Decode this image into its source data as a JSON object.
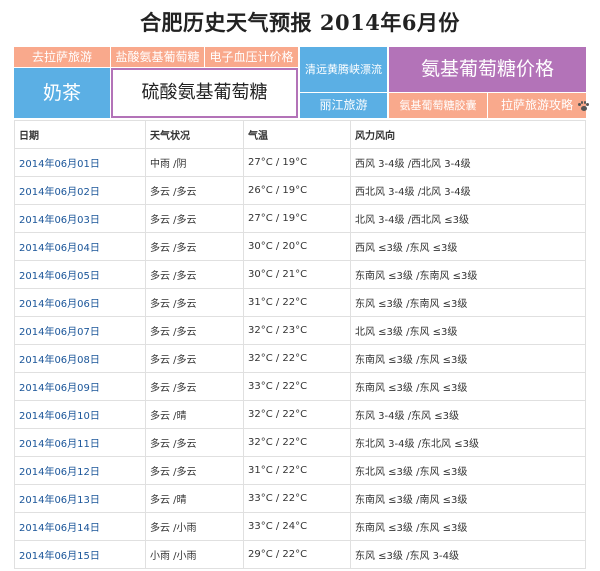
{
  "page": {
    "title": "合肥历史天气预报 2014年6月份"
  },
  "ads": {
    "lhasa_travel": "去拉萨旅游",
    "glucosamine_hcl": "盐酸氨基葡萄糖",
    "bp_monitor_price": "电子血压计价格",
    "milk_tea": "奶茶",
    "glucosamine_sulfate": "硫酸氨基葡萄糖",
    "qingyuan_rafting": "清远黄腾峡漂流",
    "glucosamine_price": "氨基葡萄糖价格",
    "lijiang_travel": "丽江旅游",
    "glucosamine_capsule": "氨基葡萄糖胶囊",
    "lhasa_guide": "拉萨旅游攻略",
    "colors": {
      "orange": "#f9a98c",
      "blue": "#5bafe4",
      "purple": "#b373b8"
    }
  },
  "table": {
    "headers": [
      "日期",
      "天气状况",
      "气温",
      "风力风向"
    ],
    "rows": [
      {
        "date": "2014年06月01日",
        "weather": "中雨 /阴",
        "temp": "27°C / 19°C",
        "wind": "西风 3-4级 /西北风 3-4级"
      },
      {
        "date": "2014年06月02日",
        "weather": "多云 /多云",
        "temp": "26°C / 19°C",
        "wind": "西北风 3-4级 /北风 3-4级"
      },
      {
        "date": "2014年06月03日",
        "weather": "多云 /多云",
        "temp": "27°C / 19°C",
        "wind": "北风 3-4级 /西北风 ≤3级"
      },
      {
        "date": "2014年06月04日",
        "weather": "多云 /多云",
        "temp": "30°C / 20°C",
        "wind": "西风 ≤3级 /东风 ≤3级"
      },
      {
        "date": "2014年06月05日",
        "weather": "多云 /多云",
        "temp": "30°C / 21°C",
        "wind": "东南风 ≤3级 /东南风 ≤3级"
      },
      {
        "date": "2014年06月06日",
        "weather": "多云 /多云",
        "temp": "31°C / 22°C",
        "wind": "东风 ≤3级 /东南风 ≤3级"
      },
      {
        "date": "2014年06月07日",
        "weather": "多云 /多云",
        "temp": "32°C / 23°C",
        "wind": "北风 ≤3级 /东风 ≤3级"
      },
      {
        "date": "2014年06月08日",
        "weather": "多云 /多云",
        "temp": "32°C / 22°C",
        "wind": "东南风 ≤3级 /东风 ≤3级"
      },
      {
        "date": "2014年06月09日",
        "weather": "多云 /多云",
        "temp": "33°C / 22°C",
        "wind": "东南风 ≤3级 /东风 ≤3级"
      },
      {
        "date": "2014年06月10日",
        "weather": "多云 /晴",
        "temp": "32°C / 22°C",
        "wind": "东风 3-4级 /东风 ≤3级"
      },
      {
        "date": "2014年06月11日",
        "weather": "多云 /多云",
        "temp": "32°C / 22°C",
        "wind": "东北风 3-4级 /东北风 ≤3级"
      },
      {
        "date": "2014年06月12日",
        "weather": "多云 /多云",
        "temp": "31°C / 22°C",
        "wind": "东北风 ≤3级 /东风 ≤3级"
      },
      {
        "date": "2014年06月13日",
        "weather": "多云 /晴",
        "temp": "33°C / 22°C",
        "wind": "东南风 ≤3级 /南风 ≤3级"
      },
      {
        "date": "2014年06月14日",
        "weather": "多云 /小雨",
        "temp": "33°C / 24°C",
        "wind": "东南风 ≤3级 /东风 ≤3级"
      },
      {
        "date": "2014年06月15日",
        "weather": "小雨 /小雨",
        "temp": "29°C / 22°C",
        "wind": "东风 ≤3级 /东风 3-4级"
      }
    ]
  }
}
